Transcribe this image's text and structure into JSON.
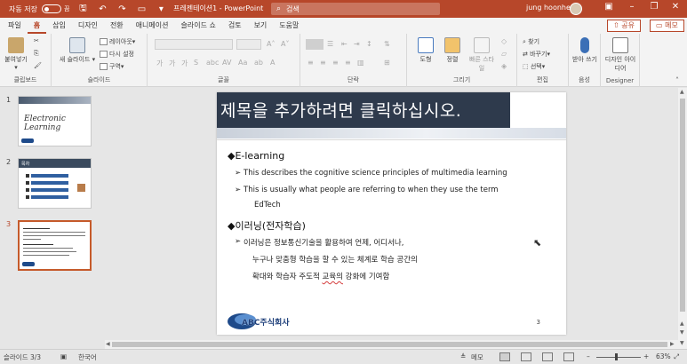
{
  "titlebar": {
    "autosave_label": "자동 저장",
    "autosave_state": "끔",
    "doc_title": "프레젠테이션1 - PowerPoint",
    "search_placeholder": "검색",
    "user_name": "jung hoonhee",
    "bg_color": "#b7472a"
  },
  "tabs": [
    "파일",
    "홈",
    "삽입",
    "디자인",
    "전환",
    "애니메이션",
    "슬라이드 쇼",
    "검토",
    "보기",
    "도움말"
  ],
  "active_tab": "홈",
  "share_label": "공유",
  "memo_label": "메모",
  "ribbon": {
    "clipboard": {
      "paste": "붙여넣기",
      "label": "클립보드"
    },
    "slides": {
      "new_slide": "새 슬라이드",
      "layout": "레이아웃",
      "reset": "다시 설정",
      "section": "구역",
      "label": "슬라이드"
    },
    "font": {
      "label": "글꼴"
    },
    "paragraph": {
      "label": "단락"
    },
    "drawing": {
      "shape": "도형",
      "arrange": "정렬",
      "quick_style": "빠른 스타일",
      "label": "그리기"
    },
    "editing": {
      "find": "찾기",
      "replace": "바꾸기",
      "select": "선택",
      "label": "편집"
    },
    "voice": {
      "dictate": "받아 쓰기",
      "label": "음성"
    },
    "designer": {
      "ideas": "디자인 아이디어",
      "label": "Designer"
    }
  },
  "thumbnails": [
    {
      "num": "1",
      "title": "Electronic Learning"
    },
    {
      "num": "2",
      "title": "목차"
    },
    {
      "num": "3",
      "title": ""
    }
  ],
  "slide": {
    "title": "제목을 추가하려면 클릭하십시오.",
    "heading1": "◆E-learning",
    "bullet1": "This describes the cognitive science principles of multimedia learning",
    "bullet2": "This is usually what people are referring to when they use the term",
    "bullet2_cont": "EdTech",
    "heading2": "◆이러닝(전자학습)",
    "bullet3": "이러닝은 정보통신기술을 활용하여 언제, 어디서나,",
    "bullet3_cont1": "누구나 맞춤형 학습을 할 수 있는 체계로 학습 공간의",
    "bullet3_cont2_a": "확대와 학습자 주도적 ",
    "bullet3_cont2_b": "교육의",
    "bullet3_cont2_c": " 강화에 기여함",
    "logo_text": "ABC주식회사",
    "number": "3"
  },
  "status": {
    "slide_info": "슬라이드 3/3",
    "language": "한국어",
    "notes": "메모",
    "zoom": "63%"
  }
}
